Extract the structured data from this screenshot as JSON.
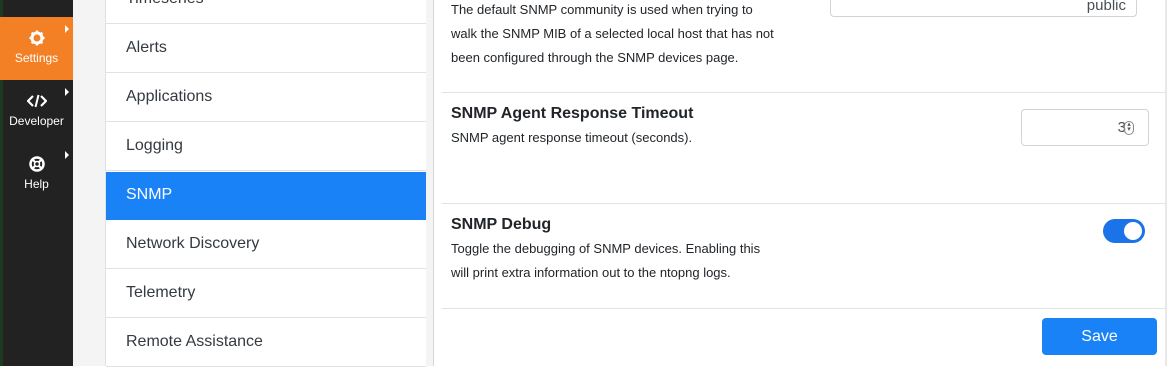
{
  "nav": {
    "items": [
      {
        "label": "Settings",
        "icon": "gear-icon",
        "active": true
      },
      {
        "label": "Developer",
        "icon": "code-icon",
        "active": false
      },
      {
        "label": "Help",
        "icon": "lifebuoy-icon",
        "active": false
      }
    ]
  },
  "submenu": {
    "items": [
      {
        "label": "Timeseries"
      },
      {
        "label": "Alerts"
      },
      {
        "label": "Applications"
      },
      {
        "label": "Logging"
      },
      {
        "label": "SNMP",
        "active": true
      },
      {
        "label": "Network Discovery"
      },
      {
        "label": "Telemetry"
      },
      {
        "label": "Remote Assistance"
      }
    ]
  },
  "settings": {
    "community": {
      "description": "The default SNMP community is used when trying to walk the SNMP MIB of a selected local host that has not been configured through the SNMP devices page.",
      "value": "public"
    },
    "timeout": {
      "title": "SNMP Agent Response Timeout",
      "description": "SNMP agent response timeout (seconds).",
      "value": "3"
    },
    "debug": {
      "title": "SNMP Debug",
      "description": "Toggle the debugging of SNMP devices. Enabling this will print extra information out to the ntopng logs.",
      "enabled": true
    }
  },
  "actions": {
    "save_label": "Save"
  },
  "colors": {
    "accent": "#f38025",
    "primary": "#1a82f7",
    "nav_bg": "#222222"
  }
}
